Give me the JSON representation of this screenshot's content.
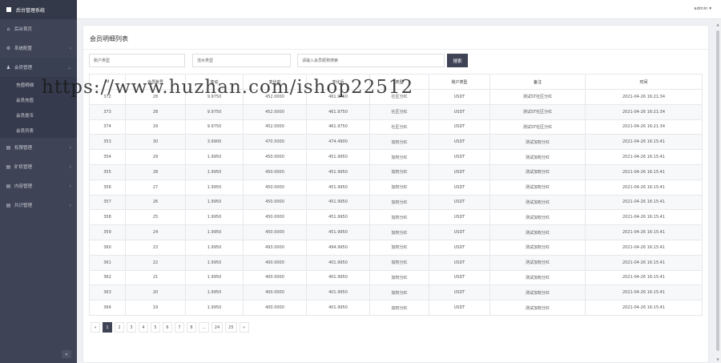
{
  "app": {
    "title": "后台管理系统",
    "user": "admin"
  },
  "sidebar": {
    "items": [
      {
        "label": "后台首页",
        "icon": "home-icon"
      },
      {
        "label": "系统配置",
        "icon": "gear-icon"
      },
      {
        "label": "会员管理",
        "icon": "user-icon"
      },
      {
        "label": "权限管理",
        "icon": "grid-icon"
      },
      {
        "label": "矿机管理",
        "icon": "grid-icon"
      },
      {
        "label": "内容管理",
        "icon": "grid-icon"
      },
      {
        "label": "共识管理",
        "icon": "grid-icon"
      }
    ],
    "subitems": [
      "充值明细",
      "会员充值",
      "会员提币",
      "会员列表"
    ],
    "collapse_label": "«"
  },
  "page": {
    "title": "会员明细列表",
    "filters": {
      "account_type_placeholder": "账户类型",
      "flow_type_placeholder": "流水类型",
      "search_placeholder": "请输入会员昵称搜索",
      "search_button": "搜索"
    }
  },
  "table": {
    "headers": [
      "Id",
      "会员账号",
      "变动",
      "变化前",
      "变化后",
      "类型",
      "账户类型",
      "备注",
      "时间"
    ],
    "rows": [
      [
        "372",
        "28",
        "9.9750",
        "452.0000",
        "461.9750",
        "社区分红",
        "USDT",
        "测试ST社区分红",
        "2021-04-26 16:21:34"
      ],
      [
        "373",
        "28",
        "9.9750",
        "452.0000",
        "461.9750",
        "社区分红",
        "USDT",
        "测试ST社区分红",
        "2021-04-26 16:21:34"
      ],
      [
        "374",
        "29",
        "9.9750",
        "452.0000",
        "461.9750",
        "社区分红",
        "USDT",
        "测试ST社区分红",
        "2021-04-26 16:21:34"
      ],
      [
        "353",
        "30",
        "3.9900",
        "470.5000",
        "474.4900",
        "加权分红",
        "USDT",
        "测试加权分红",
        "2021-04-26 16:15:41"
      ],
      [
        "354",
        "29",
        "1.9950",
        "450.0000",
        "451.9950",
        "加权分红",
        "USDT",
        "测试加权分红",
        "2021-04-26 16:15:41"
      ],
      [
        "355",
        "28",
        "1.9950",
        "450.0000",
        "451.9950",
        "加权分红",
        "USDT",
        "测试加权分红",
        "2021-04-26 16:15:41"
      ],
      [
        "356",
        "27",
        "1.9950",
        "450.0000",
        "451.9950",
        "加权分红",
        "USDT",
        "测试加权分红",
        "2021-04-26 16:15:41"
      ],
      [
        "357",
        "26",
        "1.9950",
        "450.0000",
        "451.9950",
        "加权分红",
        "USDT",
        "测试加权分红",
        "2021-04-26 16:15:41"
      ],
      [
        "358",
        "25",
        "1.9950",
        "450.0000",
        "451.9950",
        "加权分红",
        "USDT",
        "测试加权分红",
        "2021-04-26 16:15:41"
      ],
      [
        "359",
        "24",
        "1.9950",
        "450.0000",
        "451.9950",
        "加权分红",
        "USDT",
        "测试加权分红",
        "2021-04-26 16:15:41"
      ],
      [
        "360",
        "23",
        "1.9950",
        "493.0000",
        "494.9950",
        "加权分红",
        "USDT",
        "测试加权分红",
        "2021-04-26 16:15:41"
      ],
      [
        "361",
        "22",
        "1.9950",
        "400.0000",
        "401.9950",
        "加权分红",
        "USDT",
        "测试加权分红",
        "2021-04-26 16:15:41"
      ],
      [
        "362",
        "21",
        "1.9950",
        "400.0000",
        "401.9950",
        "加权分红",
        "USDT",
        "测试加权分红",
        "2021-04-26 16:15:41"
      ],
      [
        "363",
        "20",
        "1.9950",
        "400.0000",
        "401.9950",
        "加权分红",
        "USDT",
        "测试加权分红",
        "2021-04-26 16:15:41"
      ],
      [
        "364",
        "19",
        "1.9950",
        "400.0000",
        "401.9950",
        "加权分红",
        "USDT",
        "测试加权分红",
        "2021-04-26 16:15:41"
      ]
    ]
  },
  "pagination": {
    "prev": "«",
    "pages": [
      "1",
      "2",
      "3",
      "4",
      "5",
      "6",
      "7",
      "8",
      "...",
      "24",
      "25"
    ],
    "next": "»",
    "active": "1"
  },
  "watermark": "https://www.huzhan.com/ishop22512",
  "colors": {
    "sidebar_bg": "#3e4456",
    "accent": "#3e4456",
    "page_bg": "#eef0f3"
  }
}
